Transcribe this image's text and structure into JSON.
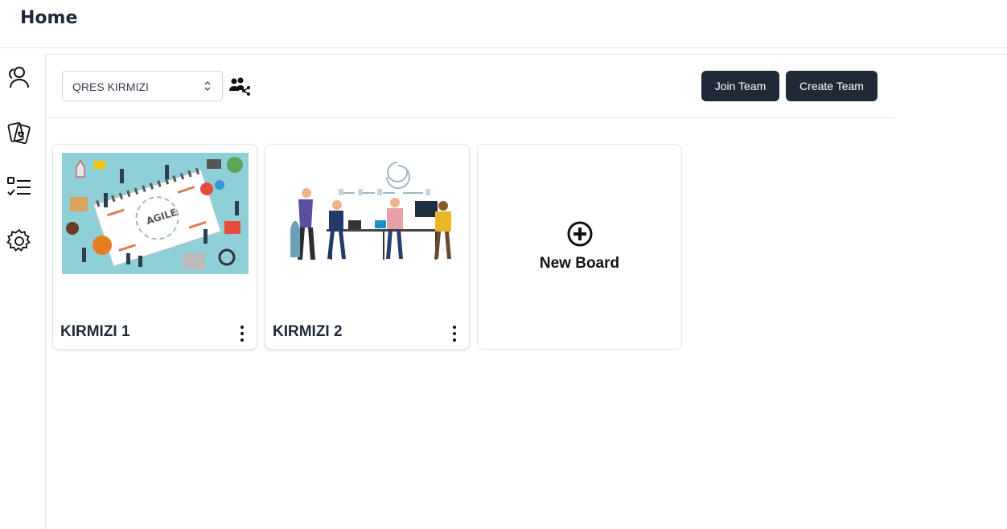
{
  "header": {
    "title": "Home"
  },
  "sidebar": {
    "items": [
      {
        "icon": "users-icon"
      },
      {
        "icon": "cards-icon"
      },
      {
        "icon": "checklist-icon"
      },
      {
        "icon": "gear-icon"
      }
    ]
  },
  "toolbar": {
    "team_select_value": "QRES KIRMIZI",
    "join_team_label": "Join Team",
    "create_team_label": "Create Team"
  },
  "boards": [
    {
      "name": "KIRMIZI 1",
      "image": "agile-illustration"
    },
    {
      "name": "KIRMIZI 2",
      "image": "team-meeting-illustration"
    }
  ],
  "new_board": {
    "label": "New Board"
  },
  "colors": {
    "primary": "#1f2937",
    "border": "#e5e7eb",
    "image_bg": "#8fd0d8"
  }
}
